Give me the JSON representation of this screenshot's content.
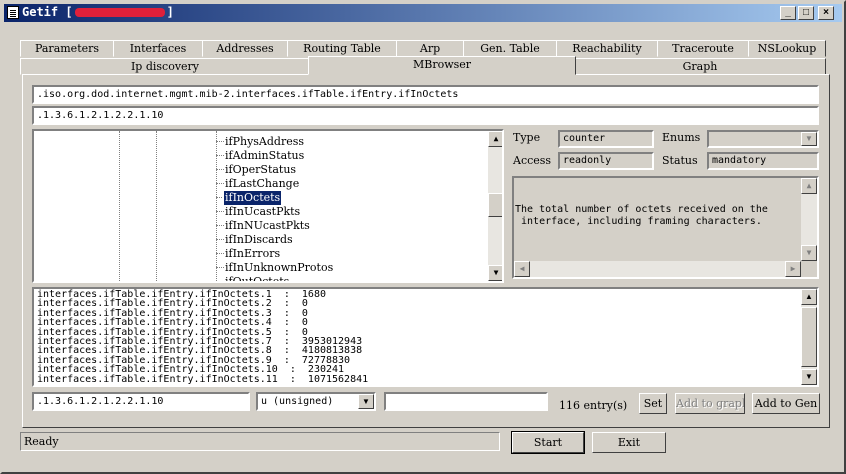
{
  "window": {
    "title": "Getif [",
    "title_end": "]"
  },
  "tabs_row1": [
    "Parameters",
    "Interfaces",
    "Addresses",
    "Routing Table",
    "Arp",
    "Gen. Table",
    "Reachability",
    "Traceroute",
    "NSLookup"
  ],
  "tabs_row2": [
    "Ip discovery",
    "MBrowser",
    "Graph"
  ],
  "active_tab": "MBrowser",
  "oid_path": ".iso.org.dod.internet.mgmt.mib-2.interfaces.ifTable.ifEntry.ifInOctets",
  "oid_numeric": ".1.3.6.1.2.1.2.2.1.10",
  "tree": {
    "items": [
      "ifPhysAddress",
      "ifAdminStatus",
      "ifOperStatus",
      "ifLastChange",
      "ifInOctets",
      "ifInUcastPkts",
      "ifInNUcastPkts",
      "ifInDiscards",
      "ifInErrors",
      "ifInUnknownProtos",
      "ifOutOctets"
    ],
    "selected_index": 4
  },
  "info": {
    "type_label": "Type",
    "type_value": "counter",
    "enums_label": "Enums",
    "enums_value": "",
    "access_label": "Access",
    "access_value": "readonly",
    "status_label": "Status",
    "status_value": "mandatory",
    "description": "The total number of octets received on the\n interface, including framing characters."
  },
  "results": [
    "interfaces.ifTable.ifEntry.ifInOctets.1  :  1680",
    "interfaces.ifTable.ifEntry.ifInOctets.2  :  0",
    "interfaces.ifTable.ifEntry.ifInOctets.3  :  0",
    "interfaces.ifTable.ifEntry.ifInOctets.4  :  0",
    "interfaces.ifTable.ifEntry.ifInOctets.5  :  0",
    "interfaces.ifTable.ifEntry.ifInOctets.7  :  3953012943",
    "interfaces.ifTable.ifEntry.ifInOctets.8  :  4180813838",
    "interfaces.ifTable.ifEntry.ifInOctets.9  :  72778830",
    "interfaces.ifTable.ifEntry.ifInOctets.10  :  230241",
    "interfaces.ifTable.ifEntry.ifInOctets.11  :  1071562841"
  ],
  "bottom": {
    "oid_input": ".1.3.6.1.2.1.2.2.1.10",
    "type_select": "u (unsigned)",
    "value_input": "",
    "entry_count": "116 entry(s)",
    "set_label": "Set",
    "add_graph_label": "Add to graph",
    "add_gen_label": "Add to Gen"
  },
  "status_text": "Ready",
  "start_label": "Start",
  "exit_label": "Exit"
}
